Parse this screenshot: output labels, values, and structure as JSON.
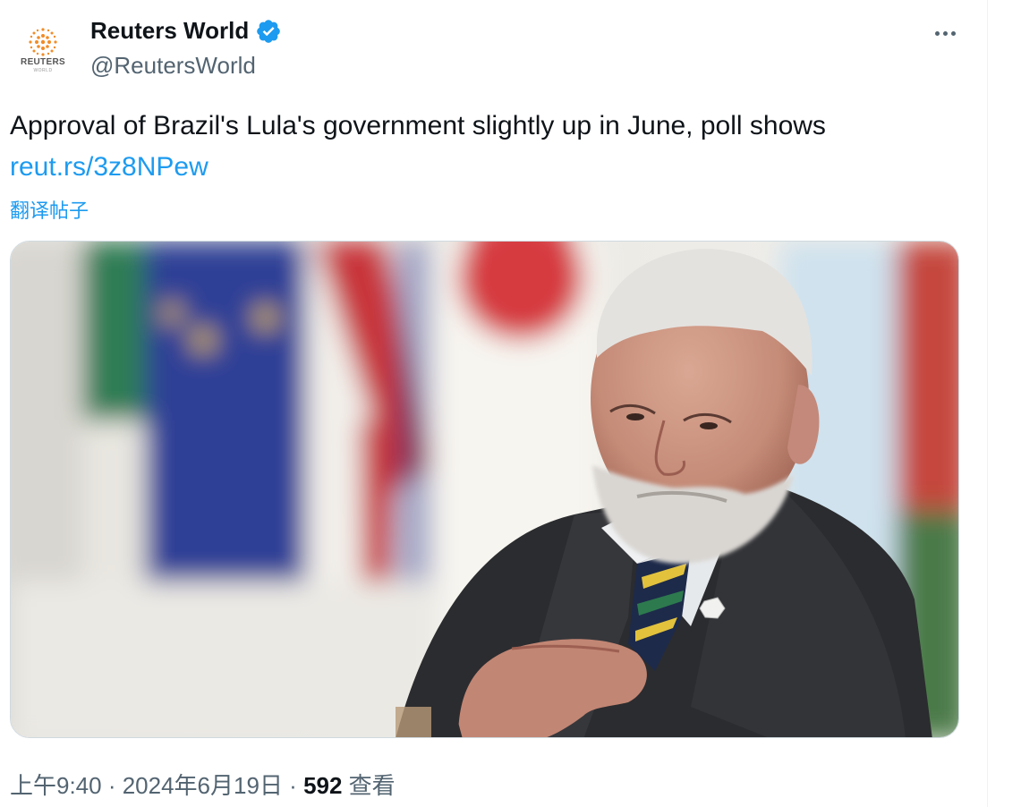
{
  "author": {
    "display_name": "Reuters World",
    "handle": "@ReutersWorld",
    "avatar_brand": "REUTERS",
    "avatar_sub": "WORLD",
    "verified_icon": "verified-badge-icon",
    "verified_color": "#1d9bf0"
  },
  "tweet": {
    "text": "Approval of Brazil's Lula's government slightly up in June, poll shows",
    "link": "reut.rs/3z8NPew",
    "translate_label": "翻译帖子"
  },
  "meta": {
    "time": "上午9:40",
    "sep1": " · ",
    "date": "2024年6月19日",
    "sep2": " · ",
    "views_count": "592",
    "views_label": " 查看"
  },
  "colors": {
    "accent": "#1d9bf0",
    "text_primary": "#0f1419",
    "text_secondary": "#536471"
  },
  "icons": {
    "more": "more-horizontal-icon",
    "logo": "reuters-logo-icon"
  }
}
